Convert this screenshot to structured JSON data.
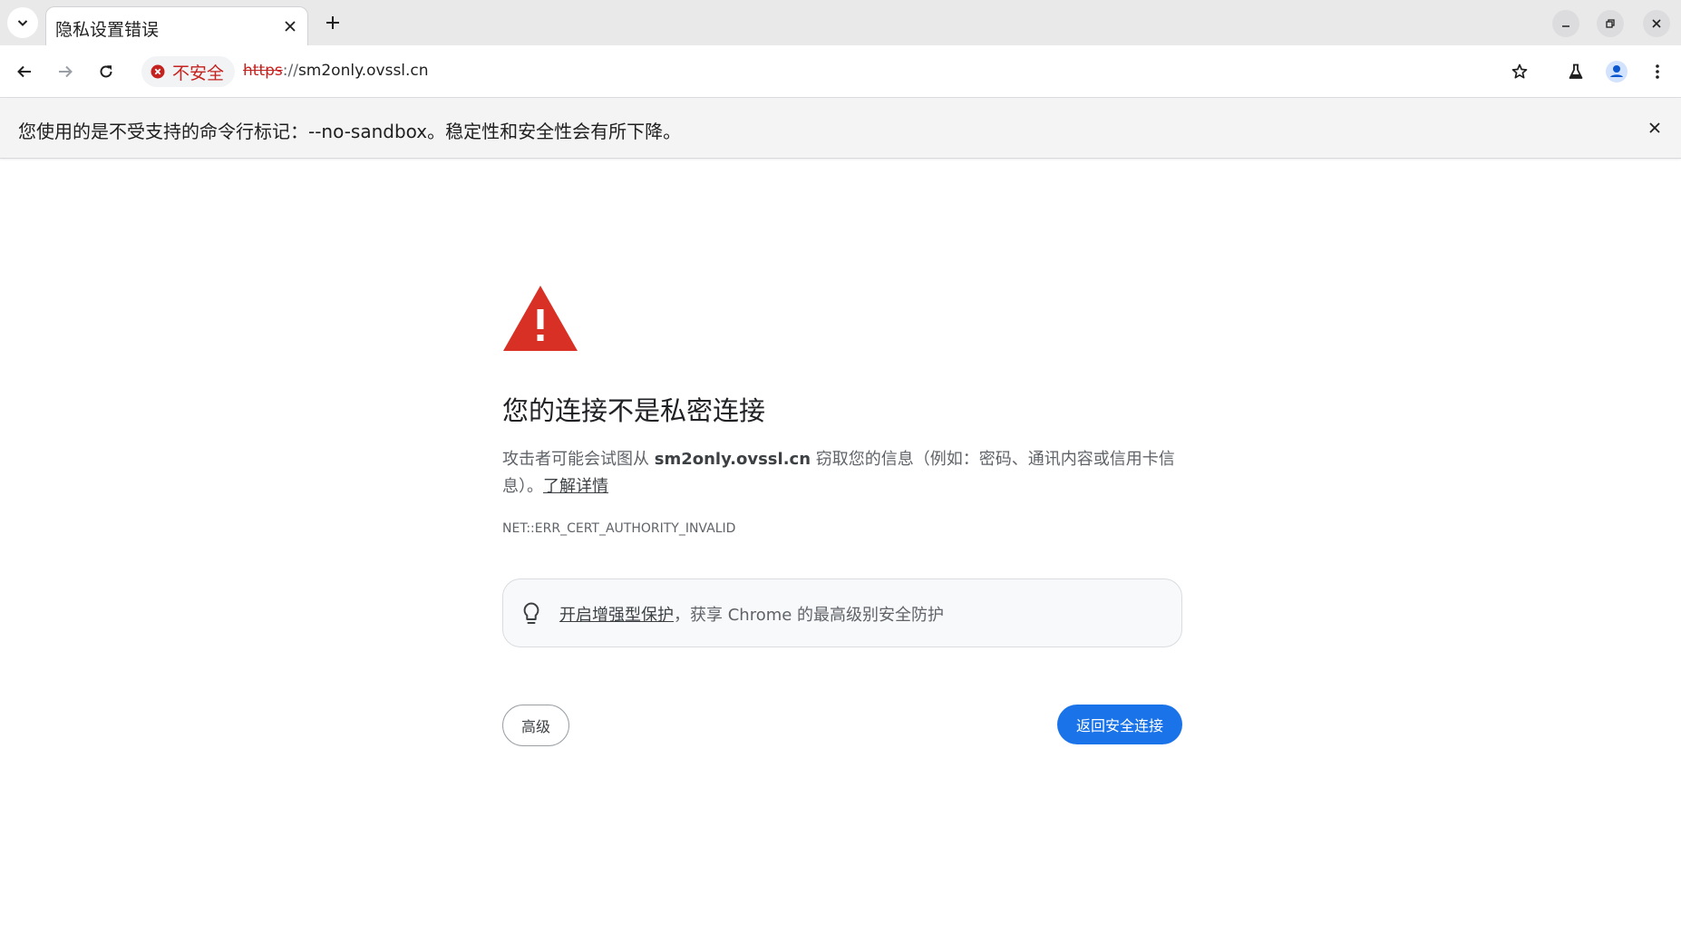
{
  "tabs": [
    {
      "title": "隐私设置错误",
      "active": true
    }
  ],
  "omnibox": {
    "security_label": "不安全",
    "url_scheme": "https",
    "url_separator": "://",
    "url_host": "sm2only.ovssl.cn"
  },
  "infobar": {
    "message": "您使用的是不受支持的命令行标记：--no-sandbox。稳定性和安全性会有所下降。"
  },
  "interstitial": {
    "heading": "您的连接不是私密连接",
    "explanation_before": "攻击者可能会试图从 ",
    "explanation_host": "sm2only.ovssl.cn",
    "explanation_after": " 窃取您的信息（例如：密码、通讯内容或信用卡信息）。",
    "learn_more": "了解详情",
    "error_code": "NET::ERR_CERT_AUTHORITY_INVALID",
    "enhanced_link": "开启增强型保护",
    "enhanced_rest": "，获享 Chrome 的最高级别安全防护",
    "advanced_button": "高级",
    "back_button": "返回安全连接"
  },
  "icons": {
    "tab_search": "chevron-down-icon",
    "tab_close": "close-icon",
    "new_tab": "plus-icon",
    "back": "arrow-left-icon",
    "forward": "arrow-right-icon",
    "reload": "reload-icon",
    "security": "error-circle-icon",
    "bookmark": "star-icon",
    "labs": "flask-icon",
    "profile": "person-icon",
    "menu": "kebab-menu-icon",
    "warning": "warning-triangle-icon",
    "tip": "lightbulb-icon"
  },
  "colors": {
    "danger": "#c5221f",
    "warning_red": "#d93025",
    "primary_button": "#1a73e8"
  }
}
